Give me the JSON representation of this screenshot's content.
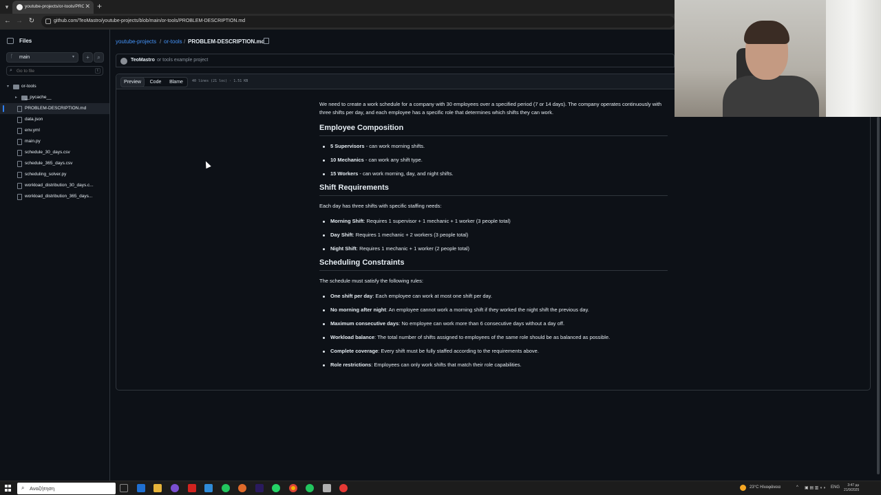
{
  "browser": {
    "tab_title": "youtube-projects/or-tools/PRO",
    "url": "github.com/TeoMastro/youtube-projects/blob/main/or-tools/PROBLEM-DESCRIPTION.md"
  },
  "sidebar": {
    "title": "Files",
    "branch": "main",
    "goto_placeholder": "Go to file",
    "goto_shortcut": "t",
    "tree": [
      {
        "label": "or-tools",
        "type": "folder",
        "depth": 0
      },
      {
        "label": "__pycache__",
        "type": "folder",
        "depth": 1
      },
      {
        "label": "PROBLEM-DESCRIPTION.md",
        "type": "file",
        "depth": 1,
        "active": true
      },
      {
        "label": "data.json",
        "type": "file",
        "depth": 1
      },
      {
        "label": "env.yml",
        "type": "file",
        "depth": 1
      },
      {
        "label": "main.py",
        "type": "file",
        "depth": 1
      },
      {
        "label": "schedule_30_days.csv",
        "type": "file",
        "depth": 1
      },
      {
        "label": "schedule_365_days.csv",
        "type": "file",
        "depth": 1
      },
      {
        "label": "scheduling_solver.py",
        "type": "file",
        "depth": 1
      },
      {
        "label": "workload_distribution_30_days.c...",
        "type": "file",
        "depth": 1
      },
      {
        "label": "workload_distribution_365_days...",
        "type": "file",
        "depth": 1
      }
    ]
  },
  "breadcrumb": {
    "repo": "youtube-projects",
    "folder": "or-tools",
    "file": "PROBLEM-DESCRIPTION.md",
    "sep": "/"
  },
  "commit": {
    "author": "TeoMastro",
    "message": "or tools example project"
  },
  "file_view": {
    "tabs": [
      "Preview",
      "Code",
      "Blame"
    ],
    "selected_tab": "Preview",
    "meta": "40 lines (21 loc) · 1.51 KB"
  },
  "doc": {
    "intro": "We need to create a work schedule for a company with 30 employees over a specified period (7 or 14 days). The company operates continuously with three shifts per day, and each employee has a specific role that determines which shifts they can work.",
    "sections": [
      {
        "heading": "Employee Composition",
        "lead": "",
        "items": [
          {
            "bold": "5 Supervisors",
            "text": " - can work morning shifts."
          },
          {
            "bold": "10 Mechanics",
            "text": " - can work any shift type."
          },
          {
            "bold": "15 Workers",
            "text": " - can work morning, day, and night shifts."
          }
        ]
      },
      {
        "heading": "Shift Requirements",
        "lead": "Each day has three shifts with specific staffing needs:",
        "items": [
          {
            "bold": "Morning Shift",
            "text": ": Requires 1 supervisor + 1 mechanic + 1 worker (3 people total)"
          },
          {
            "bold": "Day Shift",
            "text": ": Requires 1 mechanic + 2 workers (3 people total)"
          },
          {
            "bold": "Night Shift",
            "text": ": Requires 1 mechanic + 1 worker (2 people total)"
          }
        ]
      },
      {
        "heading": "Scheduling Constraints",
        "lead": "The schedule must satisfy the following rules:",
        "items": [
          {
            "bold": "One shift per day",
            "text": ": Each employee can work at most one shift per day."
          },
          {
            "bold": "No morning after night",
            "text": ": An employee cannot work a morning shift if they worked the night shift the previous day."
          },
          {
            "bold": "Maximum consecutive days",
            "text": ": No employee can work more than 6 consecutive days without a day off."
          },
          {
            "bold": "Workload balance",
            "text": ": The total number of shifts assigned to employees of the same role should be as balanced as possible."
          },
          {
            "bold": "Complete coverage",
            "text": ": Every shift must be fully staffed according to the requirements above."
          },
          {
            "bold": "Role restrictions",
            "text": ": Employees can only work shifts that match their role capabilities."
          }
        ]
      }
    ]
  },
  "taskbar": {
    "search_placeholder": "Αναζήτηση",
    "weather": "23°C Ηλιοφάνεια",
    "lang": "ENG",
    "time": "3:47 μμ",
    "date": "21/9/2025"
  },
  "colors": {
    "background": "#0d1117",
    "link": "#4493f8",
    "border": "#30363d",
    "text": "#e6edf3",
    "muted": "#8b949e"
  }
}
